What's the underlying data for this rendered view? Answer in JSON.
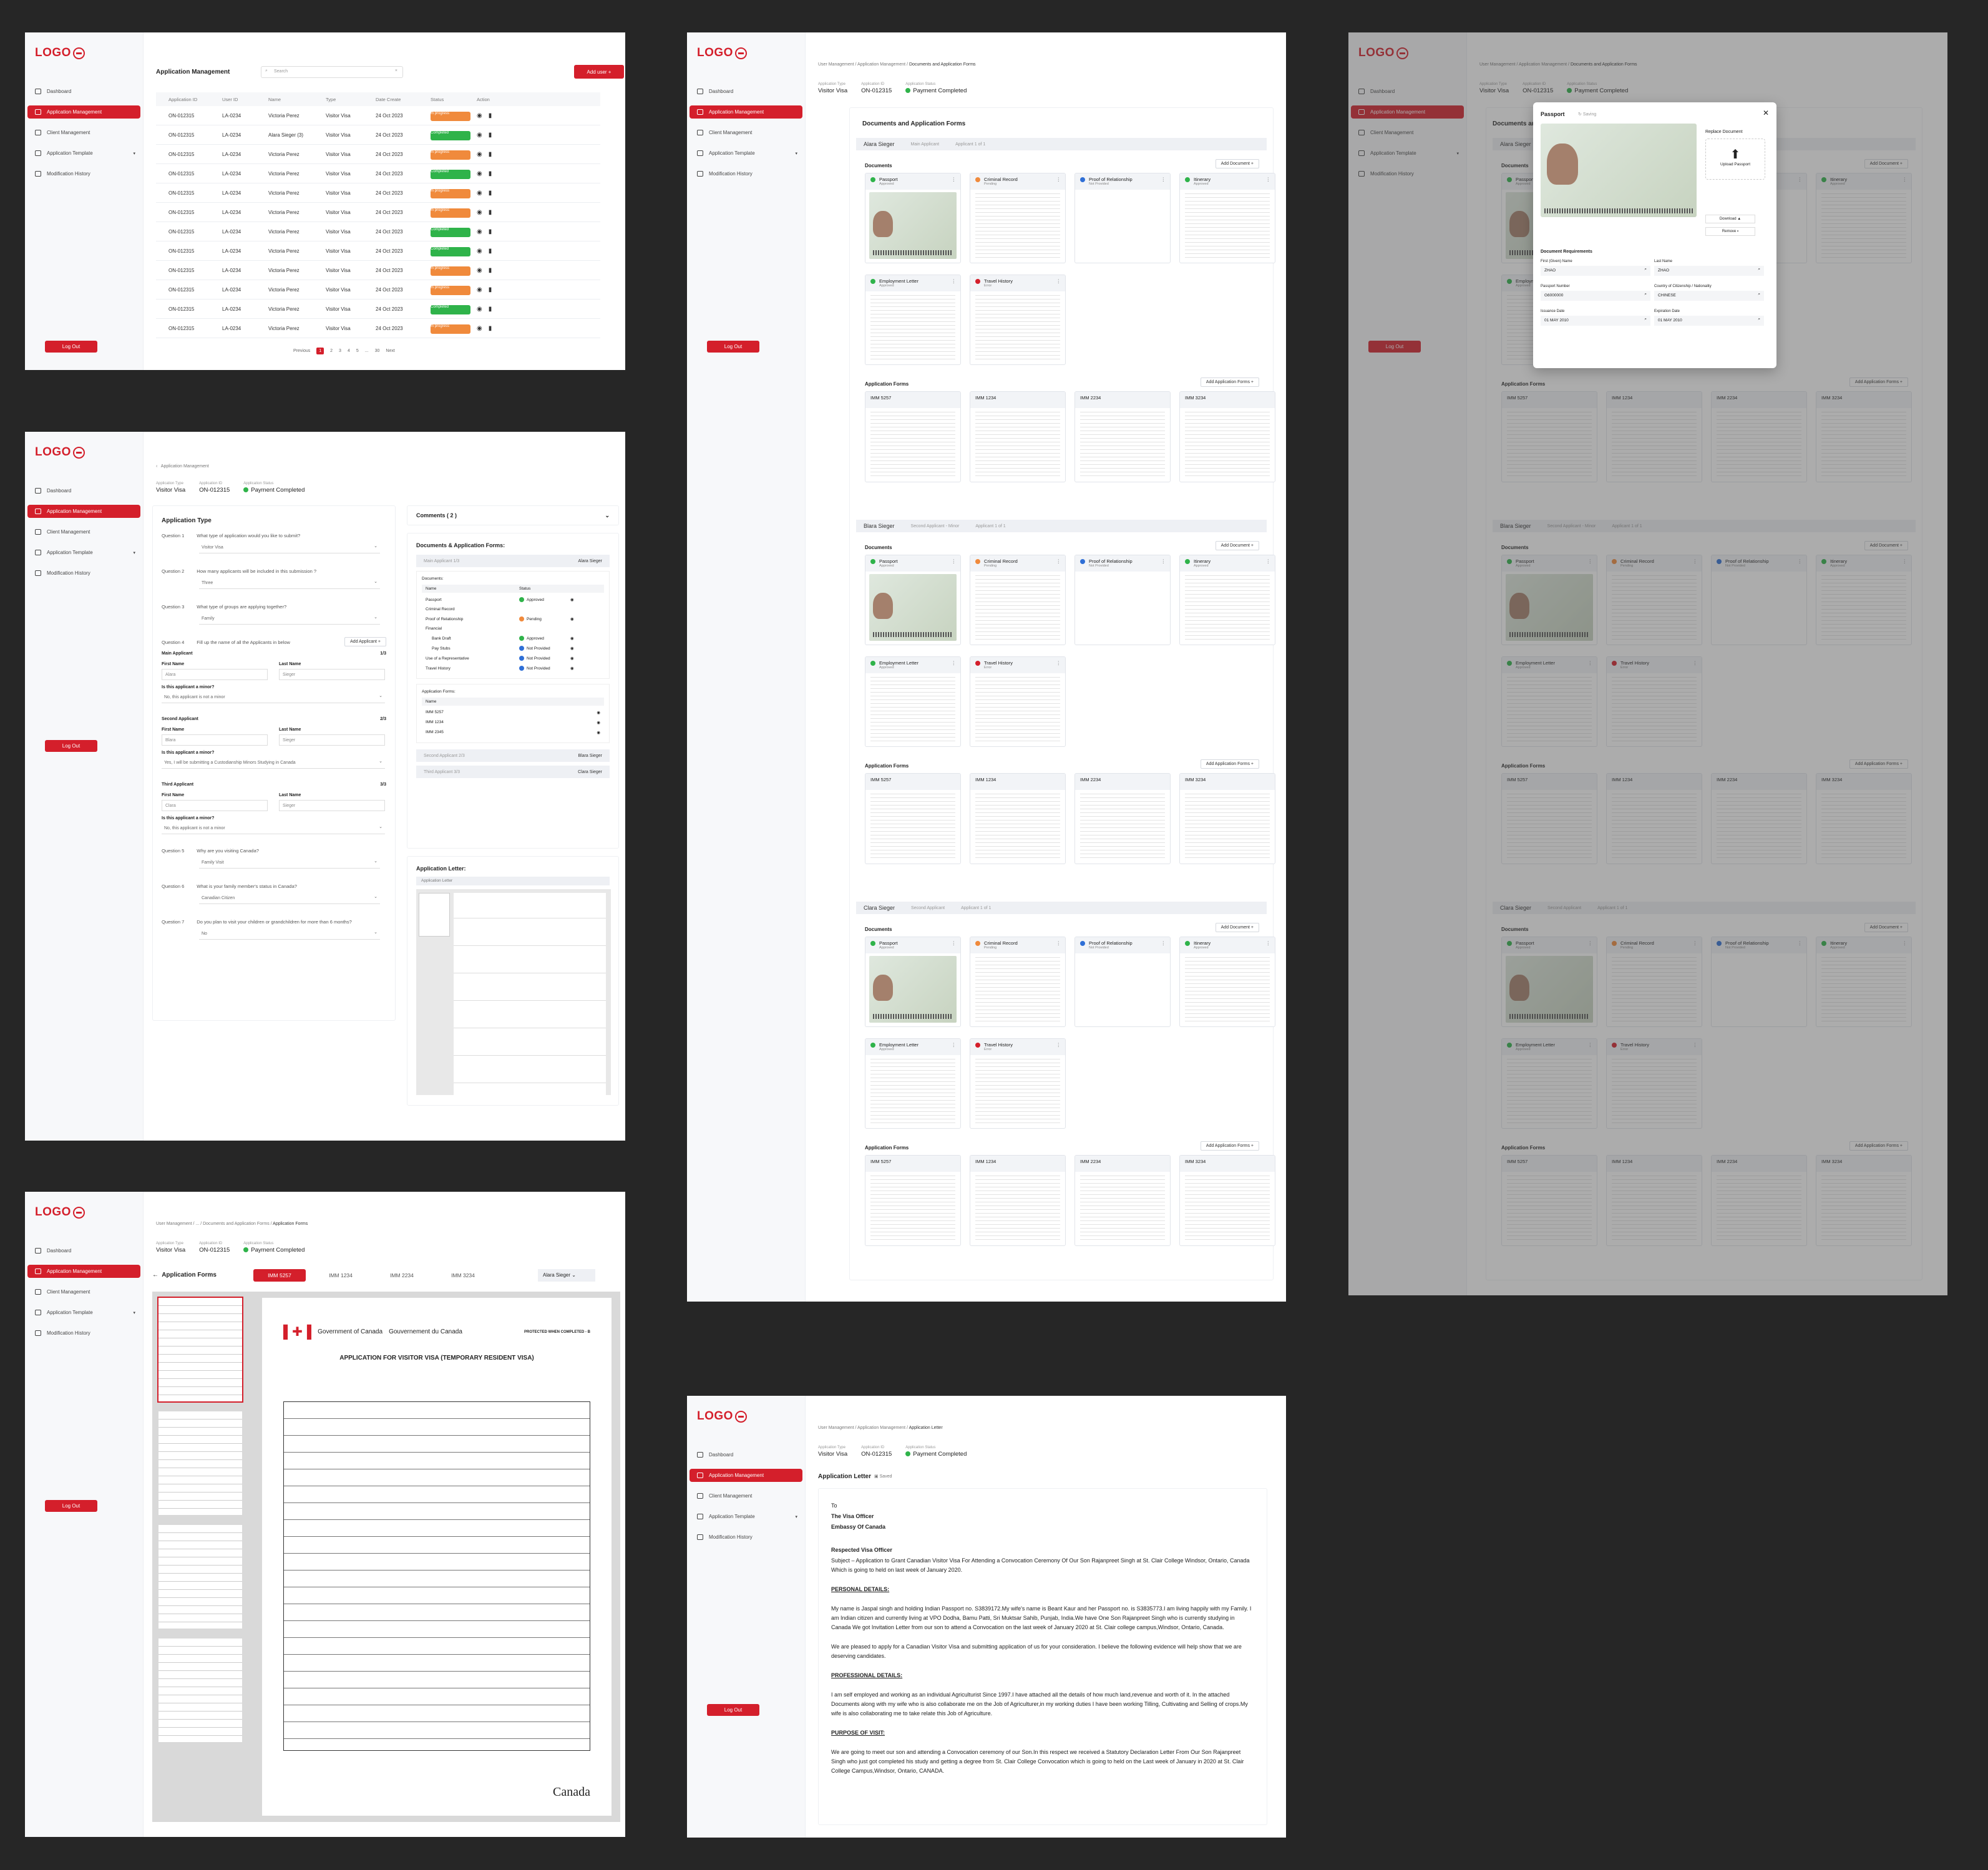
{
  "logo": "LOGO",
  "nav": {
    "dashboard": "Dashboard",
    "app_mgmt": "Application Management",
    "client_mgmt": "Client Management",
    "app_template": "Application Template",
    "mod_history": "Modification History",
    "logout": "Log Out"
  },
  "s1": {
    "title": "Application Management",
    "search_placeholder": "Search",
    "add_user": "Add user",
    "headers": [
      "Application ID",
      "User ID",
      "Name",
      "Type",
      "Date Create",
      "Status",
      "Action"
    ],
    "rows": [
      [
        "ON-012315",
        "LA-0234",
        "Victoria Perez",
        "Visitor Visa",
        "24 Oct 2023",
        "In progress"
      ],
      [
        "ON-012315",
        "LA-0234",
        "Alara Sieger (3)",
        "Visitor Visa",
        "24 Oct 2023",
        "Completed"
      ],
      [
        "ON-012315",
        "LA-0234",
        "Victoria Perez",
        "Visitor Visa",
        "24 Oct 2023",
        "In progress"
      ],
      [
        "ON-012315",
        "LA-0234",
        "Victoria Perez",
        "Visitor Visa",
        "24 Oct 2023",
        "Completed"
      ],
      [
        "ON-012315",
        "LA-0234",
        "Victoria Perez",
        "Visitor Visa",
        "24 Oct 2023",
        "In progress"
      ],
      [
        "ON-012315",
        "LA-0234",
        "Victoria Perez",
        "Visitor Visa",
        "24 Oct 2023",
        "In progress"
      ],
      [
        "ON-012315",
        "LA-0234",
        "Victoria Perez",
        "Visitor Visa",
        "24 Oct 2023",
        "Completed"
      ],
      [
        "ON-012315",
        "LA-0234",
        "Victoria Perez",
        "Visitor Visa",
        "24 Oct 2023",
        "Completed"
      ],
      [
        "ON-012315",
        "LA-0234",
        "Victoria Perez",
        "Visitor Visa",
        "24 Oct 2023",
        "In progress"
      ],
      [
        "ON-012315",
        "LA-0234",
        "Victoria Perez",
        "Visitor Visa",
        "24 Oct 2023",
        "In progress"
      ],
      [
        "ON-012315",
        "LA-0234",
        "Victoria Perez",
        "Visitor Visa",
        "24 Oct 2023",
        "Completed"
      ],
      [
        "ON-012315",
        "LA-0234",
        "Victoria Perez",
        "Visitor Visa",
        "24 Oct 2023",
        "In progress"
      ]
    ],
    "pager": {
      "prev": "Previous",
      "pages": [
        "1",
        "2",
        "3",
        "4",
        "5",
        "...",
        "30"
      ],
      "next": "Next"
    }
  },
  "meta": {
    "type_l": "Application Type",
    "type_v": "Visitor Visa",
    "id_l": "Application ID",
    "id_v": "ON-012315",
    "status_l": "Application Status",
    "status_v": "Payment Completed"
  },
  "crumbs": {
    "a": "User Management",
    "b": "Application Management",
    "c": "Documents and Application Forms",
    "d": "Application Forms",
    "e": "Application Letter"
  },
  "s2": {
    "section": "Documents and Application Forms",
    "add_doc": "Add Document",
    "add_form": "Add Application Forms",
    "docs_l": "Documents",
    "forms_l": "Application Forms",
    "applicants": [
      {
        "name": "Alara Sieger",
        "role": "Main Applicant",
        "count": "Applicant 1 of 1"
      },
      {
        "name": "Blara Sieger",
        "role": "Second Applicant - Minor",
        "count": "Applicant 1 of 1"
      },
      {
        "name": "Clara Sieger",
        "role": "Second Applicant",
        "count": "Applicant 1 of 1"
      }
    ],
    "docs": [
      {
        "name": "Passport",
        "status": "Approved",
        "color": "#2fb34a"
      },
      {
        "name": "Criminal Record",
        "status": "Pending",
        "color": "#f08a3c"
      },
      {
        "name": "Proof of Relationship",
        "status": "Not Provided",
        "color": "#2f6fd6"
      },
      {
        "name": "Itinerary",
        "status": "Approved",
        "color": "#2fb34a"
      },
      {
        "name": "Employment Letter",
        "status": "Approved",
        "color": "#2fb34a"
      },
      {
        "name": "Travel History",
        "status": "Error",
        "color": "#d41f2b"
      }
    ],
    "forms": [
      "IMM 5257",
      "IMM 1234",
      "IMM 2234",
      "IMM 3234"
    ]
  },
  "s3": {
    "title": "Passport",
    "saving": "Saving",
    "replace": "Replace Document",
    "upload": "Upload Passport",
    "download": "Download",
    "remove": "Remove",
    "req": "Document Requirements",
    "fields": [
      {
        "l": "First (Given) Name",
        "v": "ZHAO"
      },
      {
        "l": "Last Name",
        "v": "ZHAO"
      },
      {
        "l": "Passport Number",
        "v": "G6000000"
      },
      {
        "l": "Country of Citizenship / Nationality",
        "v": "CHINESE"
      },
      {
        "l": "Issuance Date",
        "v": "01 MAY 2010"
      },
      {
        "l": "Expiration Date",
        "v": "01 MAY 2010"
      }
    ]
  },
  "s4": {
    "back": "Application Type",
    "questions": [
      {
        "n": "Question 1",
        "q": "What type of application would you like to submit?",
        "a": "Visitor Visa"
      },
      {
        "n": "Question 2",
        "q": "How many applicants will be included in this submission ?",
        "a": "Three"
      },
      {
        "n": "Question 3",
        "q": "What type of groups are applying together?",
        "a": "Family"
      }
    ],
    "q4": "Fill up the name of all the Applicants in below",
    "add_applicant": "Add Applicant",
    "apps": [
      {
        "t": "Main Applicant",
        "c": "1/3",
        "f": "Alara",
        "l": "Sieger",
        "minor": "No, this applicant is not a minor"
      },
      {
        "t": "Second Applicant",
        "c": "2/3",
        "f": "Blara",
        "l": "Sieger",
        "minor": "Yes, I will be submitting a Custodianship Minors Studying in Canada"
      },
      {
        "t": "Third Applicant",
        "c": "3/3",
        "f": "Clara",
        "l": "Sieger",
        "minor": "No, this applicant is not a minor"
      }
    ],
    "first": "First Name",
    "last": "Last Name",
    "minor_q": "Is this applicant a minor?",
    "more": [
      {
        "n": "Question 5",
        "q": "Why are you visiting Canada?",
        "a": "Family Visit"
      },
      {
        "n": "Question 6",
        "q": "What is your family member's status in Canada?",
        "a": "Canadian Citizen"
      },
      {
        "n": "Question 7",
        "q": "Do you plan to visit your children or grandchildren for more than 6 months?",
        "a": "No"
      }
    ],
    "comments": "Comments ( 2 )",
    "daf": "Documents & Application Forms:",
    "main_app": "Main Applicant 1/3",
    "alara": "Alara Sieger",
    "dtable": [
      [
        "Passport",
        "Approved",
        "#2fb34a"
      ],
      [
        "Criminal Record",
        "",
        ""
      ],
      [
        "Proof of Relationship",
        "Pending",
        "#f08a3c"
      ],
      [
        "Financial",
        "",
        ""
      ],
      [
        "Bank Draft",
        "Approved",
        "#2fb34a"
      ],
      [
        "Pay Stubs",
        "Not Provided",
        "#2f6fd6"
      ],
      [
        "Use of a Representative",
        "Not Provided",
        "#2f6fd6"
      ],
      [
        "Travel History",
        "Not Provided",
        "#2f6fd6"
      ]
    ],
    "forms": [
      "IMM 5257",
      "IMM 1234",
      "IMM 2345"
    ],
    "second": "Second Applicant 2/3",
    "third": "Third Applicant 3/3",
    "blara": "Blara Sieger",
    "clara": "Clara Sieger",
    "letter": "Application Letter:",
    "letter_sub": "Application Letter",
    "name_col": "Name",
    "status_col": "Status",
    "documents": "Documents:",
    "app_forms": "Application Forms:"
  },
  "s5": {
    "title": "Application Forms",
    "tabs": [
      "IMM 5257",
      "IMM 1234",
      "IMM 2234",
      "IMM 3234"
    ],
    "who": "Alara Sieger",
    "gov": "Government of Canada",
    "gouv": "Gouvernement du Canada",
    "form_title": "APPLICATION FOR VISITOR VISA (TEMPORARY RESIDENT VISA)",
    "protected": "PROTECTED WHEN COMPLETED - B",
    "canada": "Canada"
  },
  "s6": {
    "title": "Application Letter",
    "saved": "Saved",
    "p": [
      "To",
      "The Visa Officer",
      "Embassy Of Canada",
      "Respected Visa Officer",
      "Subject – Application to Grant Canadian Visitor Visa For Attending a Convocation Ceremony Of Our Son Rajanpreet Singh at St. Clair College Windsor, Ontario, Canada Which is going to held on last week of January 2020.",
      "PERSONAL DETAILS:",
      "My name is Jaspal singh and holding Indian Passport no. S3839172.My wife's name is Beant Kaur and her Passport no. is S3835773.I am living happily with my Family. I am Indian citizen and currently living at VPO Dodha, Bamu Patti, Sri Muktsar Sahib, Punjab, India.We have One Son Rajanpreet Singh who is currently studying in Canada We got Invitation Letter from our son to attend a Convocation on the last week of January 2020 at St. Clair college campus,Windsor, Ontario, Canada.",
      "We are pleased to apply for a Canadian Visitor Visa and submitting application of us for your consideration. I believe the following evidence will help show that we are deserving candidates.",
      "PROFESSIONAL DETAILS:",
      "I am self employed and working as an individual Agriculturist Since 1997.I have attached all the details of how much land,revenue and worth of it. In the attached Documents along with my wife who is also collaborate me on the Job of Agriculturer,in my working duties I have been working Tilling, Cultivating and Selling of crops.My wife is also collaborating me to take relate this Job of Agriculture.",
      "PURPOSE OF VISIT:",
      "We are going to meet our son and attending a Convocation ceremony of our Son.In this respect we received a Statutory Declaration Letter From Our Son Rajanpreet Singh who just got completed his study and getting a degree from St. Clair College Convocation which is going to held on the Last week of January in 2020 at St. Clair College Campus,Windsor, Ontario, CANADA."
    ]
  },
  "colors": {
    "brand": "#d41f2b",
    "completed": "#2fb34a",
    "progress": "#f08a3c"
  }
}
